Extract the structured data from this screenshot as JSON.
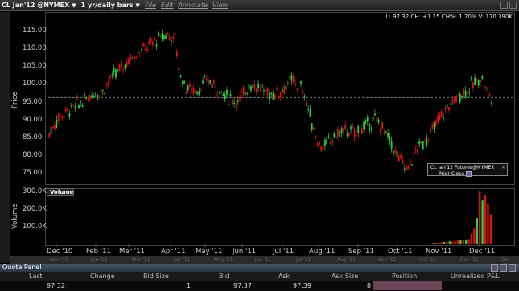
{
  "toolbar": {
    "symbol": "CL Jan'12 @NYMEX",
    "period": "1 yr/daily bars",
    "menus": [
      "File",
      "Edit",
      "Annotate",
      "View"
    ]
  },
  "status_line": "L: 97.32 CH: +1.15 CH%: 1.20% V: 170.390K",
  "legend": {
    "title": "CL Jan'12 Futures@NYMEX",
    "item": "Prior Close"
  },
  "volume_title": "Volume",
  "colors": {
    "up": "#2ecc40",
    "down": "#e01010",
    "background": "#000000",
    "grid": "#555555"
  },
  "chart_data": [
    {
      "type": "candlestick",
      "ylabel": "Price",
      "ylim": [
        72,
        118
      ],
      "yticks": [
        "115.00",
        "110.00",
        "105.00",
        "100.00",
        "95.00",
        "90.00",
        "85.00",
        "80.00",
        "75.00"
      ],
      "xticks": [
        "Dec '10",
        "Feb '11",
        "Mar '11",
        "Apr '11",
        "May '11",
        "Jun '11",
        "Jul '11",
        "Aug '11",
        "Sep '11",
        "Oct '11",
        "Nov '11",
        "Dec '11"
      ],
      "prior_close": 96.17,
      "monthly_path": [
        [
          0,
          86
        ],
        [
          0.5,
          91
        ],
        [
          1,
          93
        ],
        [
          1.6,
          95
        ],
        [
          2,
          97
        ],
        [
          2.5,
          98
        ],
        [
          3,
          102
        ],
        [
          3.5,
          105
        ],
        [
          4,
          108
        ],
        [
          4.5,
          110
        ],
        [
          5,
          112
        ],
        [
          5.5,
          114
        ],
        [
          6,
          113
        ],
        [
          6.15,
          104
        ],
        [
          6.5,
          99
        ],
        [
          7,
          98
        ],
        [
          7.5,
          101
        ],
        [
          8,
          99
        ],
        [
          8.5,
          96
        ],
        [
          9,
          95
        ],
        [
          9.5,
          100
        ],
        [
          10,
          99
        ],
        [
          10.5,
          97
        ],
        [
          11,
          98
        ],
        [
          11.5,
          101
        ],
        [
          12,
          99
        ],
        [
          12.3,
          93
        ],
        [
          12.7,
          84
        ],
        [
          13,
          82
        ],
        [
          13.5,
          85
        ],
        [
          14,
          87
        ],
        [
          14.5,
          86
        ],
        [
          15,
          88
        ],
        [
          15.5,
          90
        ],
        [
          16,
          86
        ],
        [
          16.5,
          80
        ],
        [
          17,
          76
        ],
        [
          17.5,
          82
        ],
        [
          18,
          85
        ],
        [
          18.5,
          90
        ],
        [
          19,
          94
        ],
        [
          19.5,
          97
        ],
        [
          20,
          99
        ],
        [
          20.5,
          102
        ],
        [
          20.8,
          98
        ],
        [
          21,
          96
        ]
      ]
    },
    {
      "type": "bar",
      "ylabel": "Volume",
      "ylim": [
        0,
        310000
      ],
      "yticks": [
        "300.0K",
        "200.0K",
        "100.0K"
      ],
      "recent_volumes": [
        5000,
        6000,
        8000,
        9000,
        10000,
        12000,
        14000,
        16000,
        18000,
        15000,
        20000,
        22000,
        25000,
        22000,
        28000,
        30000,
        60000,
        90000,
        150000,
        300000,
        250000,
        280000,
        230000,
        170390
      ]
    }
  ],
  "nav_labels": [
    "Nov '10",
    "Jan '11",
    "Mar '11",
    "Apr '11",
    "May '11",
    "Jun '11",
    "Jul '11",
    "Aug '11",
    "Sep '11",
    "Oct '11",
    "Dec '11",
    "Dec '11"
  ],
  "quote_panel": {
    "title": "Quote Panel",
    "headers": [
      "Last",
      "Change",
      "Bid Size",
      "Bid",
      "Ask",
      "Ask Size",
      "Position",
      "Unrealized P&L"
    ],
    "values": [
      "97.32",
      "",
      "1",
      "97.37",
      "97.39",
      "8",
      "",
      ""
    ]
  }
}
